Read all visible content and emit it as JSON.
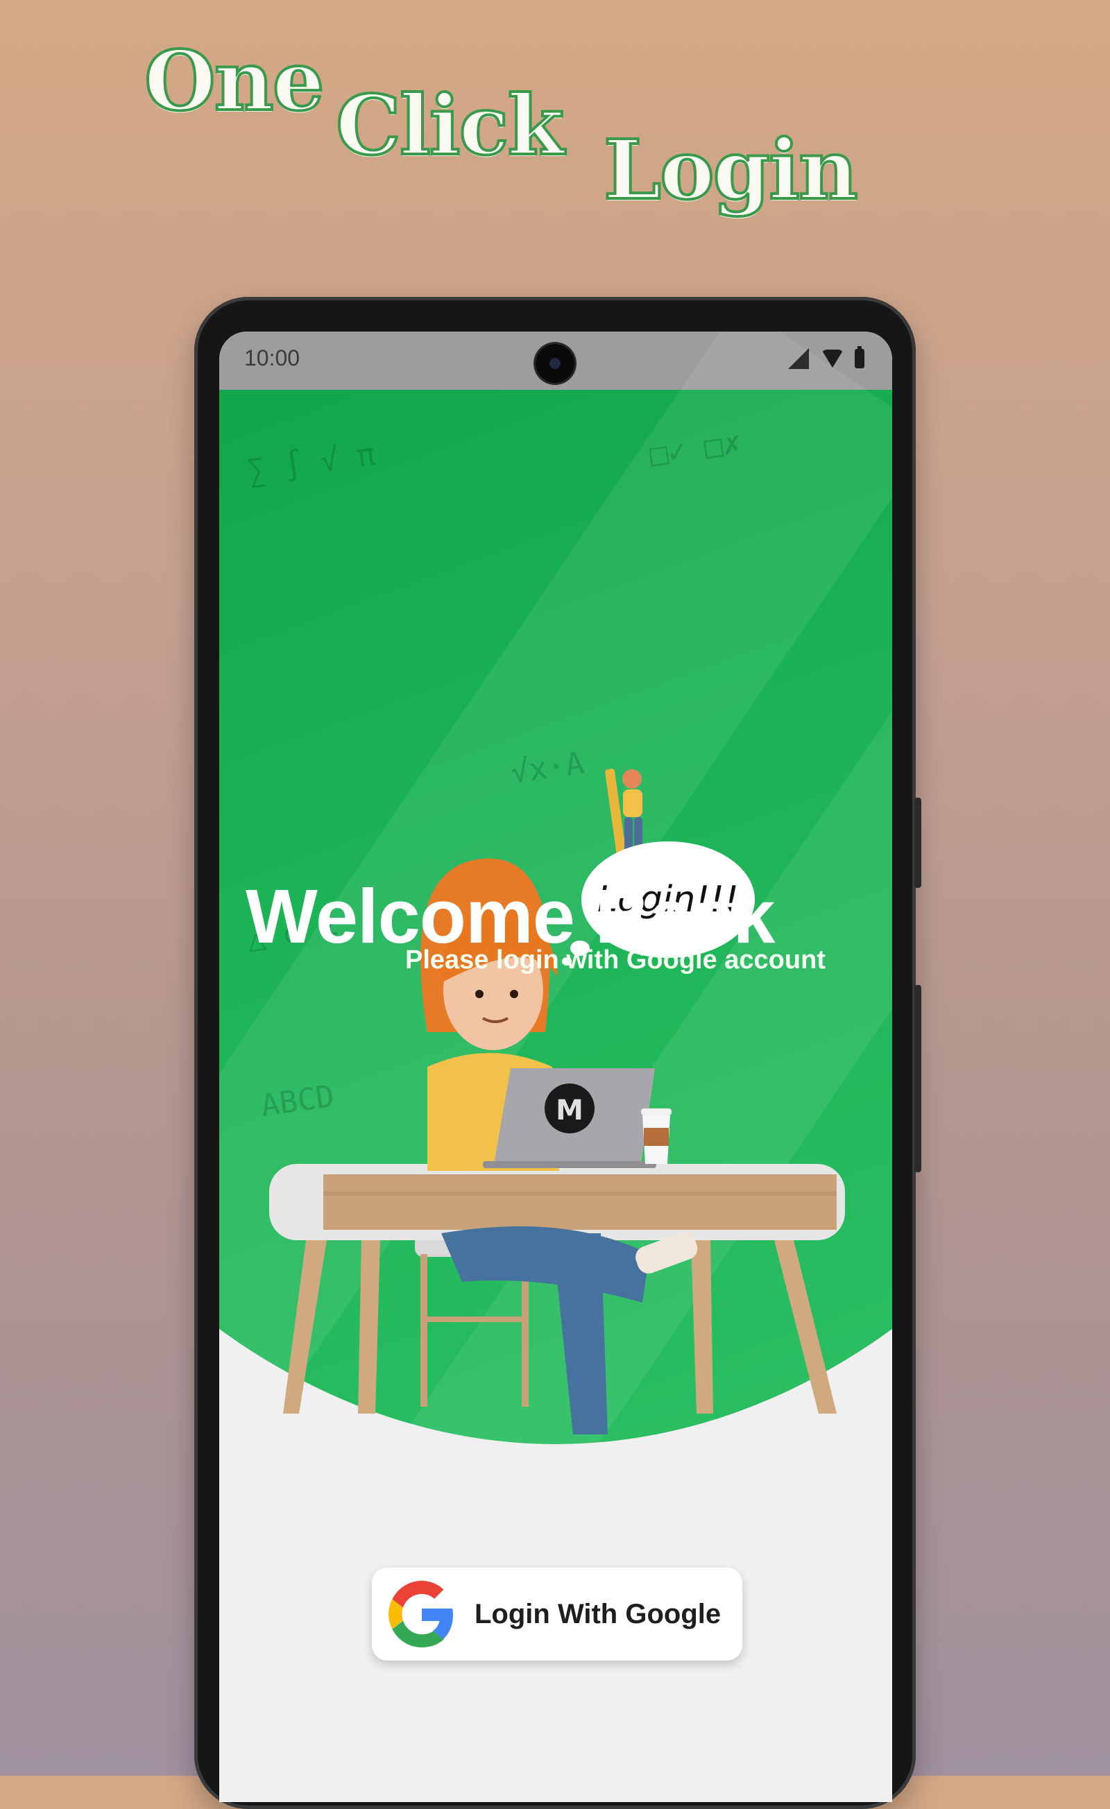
{
  "promo": {
    "headline_words": [
      "One",
      "Click",
      "Login"
    ]
  },
  "status_bar": {
    "time": "10:00",
    "icons": [
      "signal-icon",
      "wifi-icon",
      "battery-icon"
    ]
  },
  "hero": {
    "title": "Welcome Back",
    "subtitle": "Please login with Google account",
    "speech_bubble": "Login!!!",
    "laptop_logo": "M"
  },
  "login": {
    "button_label": "Login With Google",
    "icon": "google-icon"
  },
  "colors": {
    "brand_green": "#1bb356",
    "headline_outline": "#3a9a4c",
    "screen_background": "#f0f0f0"
  }
}
